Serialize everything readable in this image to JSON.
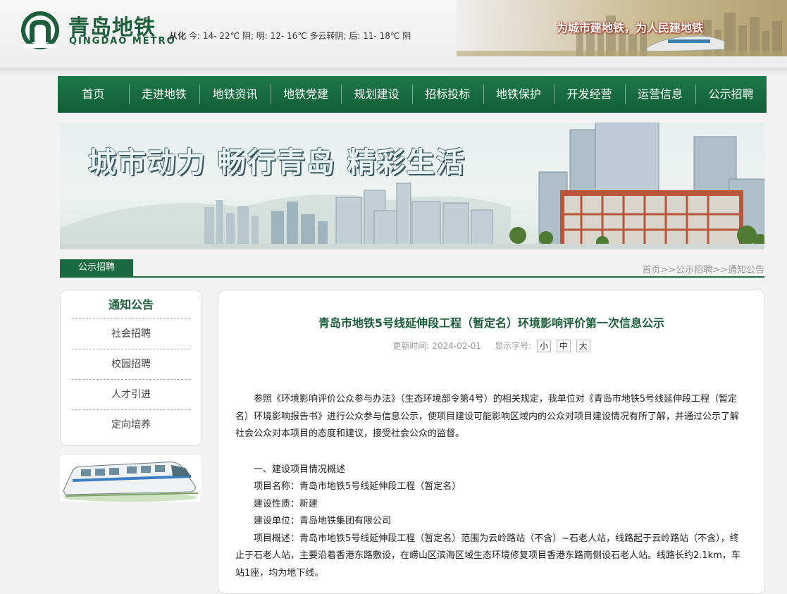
{
  "header": {
    "logo_cn": "青岛地铁",
    "logo_en": "QINGDAO METRO",
    "weather_place": "从化",
    "weather_text": "今: 14- 22℃ 阴;  明: 12- 16℃ 多云转阴;  后: 11- 18℃ 阴",
    "slogan": "为城市建地铁，为人民建地铁"
  },
  "nav": {
    "items": [
      "首页",
      "走进地铁",
      "地铁资讯",
      "地铁党建",
      "规划建设",
      "招标投标",
      "地铁保护",
      "开发经营",
      "运营信息",
      "公示招聘"
    ]
  },
  "hero": {
    "text": "城市动力  畅行青岛  精彩生活"
  },
  "section": {
    "tab": "公示招聘",
    "breadcrumb": [
      "首页",
      ">>",
      "公示招聘",
      ">>",
      "通知公告"
    ]
  },
  "sidebar": {
    "title": "通知公告",
    "items": [
      "社会招聘",
      "校园招聘",
      "人才引进",
      "定向培养"
    ]
  },
  "article": {
    "title": "青岛市地铁5号线延伸段工程（暂定名）环境影响评价第一次信息公示",
    "meta_label": "更新时间:",
    "meta_date": "2024-02-01",
    "font_label": "显示字号:",
    "font_small": "小",
    "font_medium": "中",
    "font_large": "大",
    "paragraphs": [
      "参照《环境影响评价公众参与办法》（生态环境部令第4号）的相关规定，我单位对《青岛市地铁5号线延伸段工程（暂定名）环境影响报告书》进行公众参与信息公示，使项目建设可能影响区域内的公众对项目建设情况有所了解，并通过公示了解社会公众对本项目的态度和建议，接受社会公众的监督。",
      "一、建设项目情况概述",
      "项目名称：青岛市地铁5号线延伸段工程（暂定名）",
      "建设性质：新建",
      "建设单位：青岛地铁集团有限公司",
      "项目概述：青岛市地铁5号线延伸段工程（暂定名）范围为云岭路站（不含）~石老人站，线路起于云岭路站（不含），终止于石老人站，主要沿着香港东路敷设，在崂山区滨海区域生态环境修复项目香港东路南侧设石老人站。线路长约2.1km，车站1座，均为地下线。"
    ]
  }
}
